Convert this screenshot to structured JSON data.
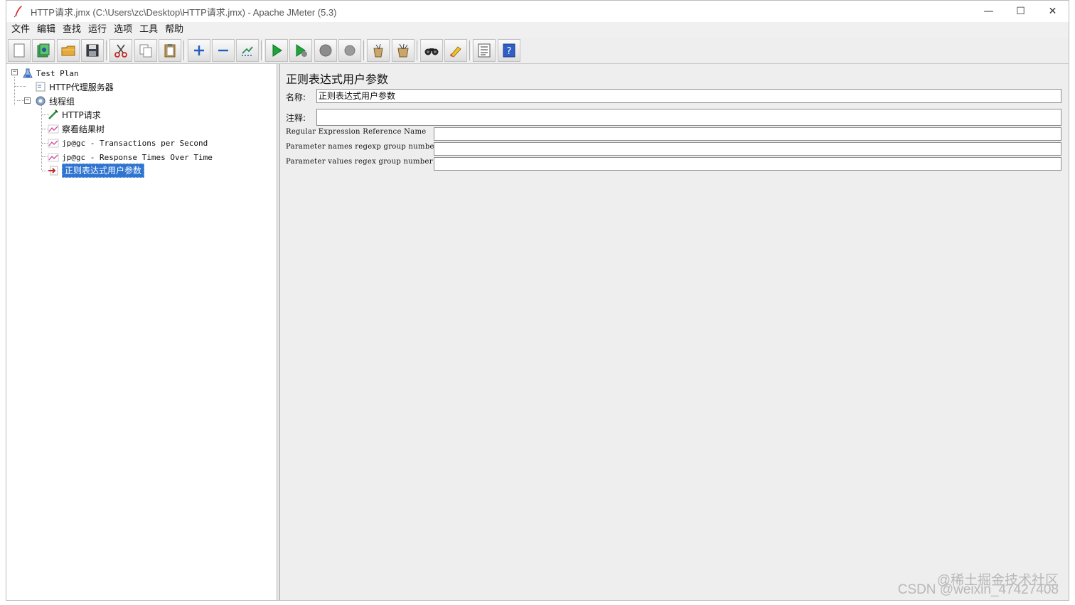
{
  "window": {
    "title": "HTTP请求.jmx (C:\\Users\\zc\\Desktop\\HTTP请求.jmx) - Apache JMeter (5.3)",
    "controls": {
      "minimize": "—",
      "maximize": "☐",
      "close": "✕"
    }
  },
  "menu": {
    "items": [
      {
        "label": "文件"
      },
      {
        "label": "编辑"
      },
      {
        "label": "查找"
      },
      {
        "label": "运行"
      },
      {
        "label": "选项"
      },
      {
        "label": "工具"
      },
      {
        "label": "帮助"
      }
    ]
  },
  "toolbar": {
    "buttons": [
      "new-icon",
      "templates-icon",
      "open-icon",
      "save-icon",
      "cut-icon",
      "copy-icon",
      "paste-icon",
      "expand-icon",
      "collapse-icon",
      "toggle-icon",
      "start-icon",
      "start-no-pause-icon",
      "stop-icon",
      "shutdown-icon",
      "clear-icon",
      "clear-all-icon",
      "search-icon",
      "reset-search-icon",
      "function-helper-icon",
      "help-icon"
    ]
  },
  "tree": {
    "nodes": [
      {
        "label": "Test Plan",
        "icon": "test-plan-icon",
        "level": 0,
        "expanded": true
      },
      {
        "label": "HTTP代理服务器",
        "icon": "proxy-icon",
        "level": 1
      },
      {
        "label": "线程组",
        "icon": "thread-group-icon",
        "level": 1,
        "expanded": true
      },
      {
        "label": "HTTP请求",
        "icon": "sampler-icon",
        "level": 2
      },
      {
        "label": "察看结果树",
        "icon": "listener-icon",
        "level": 2
      },
      {
        "label": "jp@gc - Transactions per Second",
        "icon": "listener-icon",
        "level": 2
      },
      {
        "label": "jp@gc - Response Times Over Time",
        "icon": "listener-icon",
        "level": 2
      },
      {
        "label": "正则表达式用户参数",
        "icon": "preprocessor-icon",
        "level": 2,
        "selected": true
      }
    ]
  },
  "editor": {
    "title": "正则表达式用户参数",
    "name_label": "名称:",
    "name_value": "正则表达式用户参数",
    "comment_label": "注释:",
    "comment_value": "",
    "fields": [
      {
        "label": "Regular Expression Reference Name",
        "value": ""
      },
      {
        "label": "Parameter names regexp group number",
        "value": ""
      },
      {
        "label": "Parameter values regex group number",
        "value": ""
      }
    ]
  },
  "watermark": {
    "line1": "@稀土掘金技术社区",
    "line2": "CSDN @weixin_47427408"
  }
}
